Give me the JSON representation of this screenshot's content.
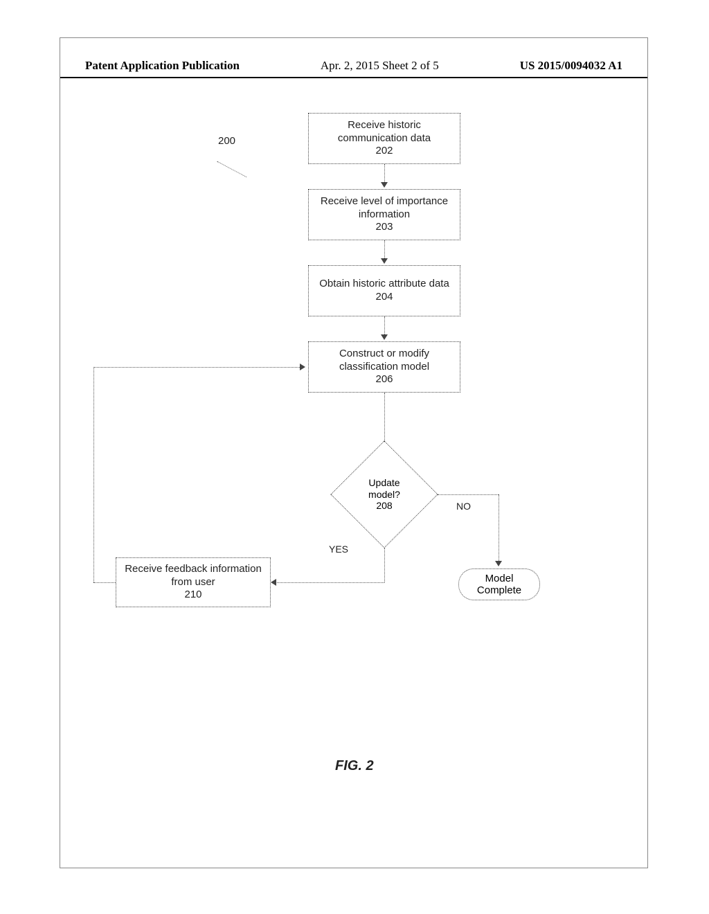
{
  "header": {
    "left": "Patent Application Publication",
    "mid": "Apr. 2, 2015  Sheet 2 of 5",
    "right": "US 2015/0094032 A1"
  },
  "figure_ref": "200",
  "boxes": {
    "b202": {
      "l1": "Receive historic",
      "l2": "communication data",
      "ref": "202"
    },
    "b203": {
      "l1": "Receive level of importance",
      "l2": "information",
      "ref": "203"
    },
    "b204": {
      "l1": "Obtain historic attribute data",
      "ref": "204"
    },
    "b206": {
      "l1": "Construct or modify",
      "l2": "classification model",
      "ref": "206"
    },
    "decision": {
      "l1": "Update",
      "l2": "model?",
      "ref": "208"
    },
    "b210": {
      "l1": "Receive feedback information",
      "l2": "from user",
      "ref": "210"
    },
    "terminator": {
      "l1": "Model",
      "l2": "Complete"
    }
  },
  "labels": {
    "yes": "YES",
    "no": "NO"
  },
  "caption": "FIG. 2"
}
